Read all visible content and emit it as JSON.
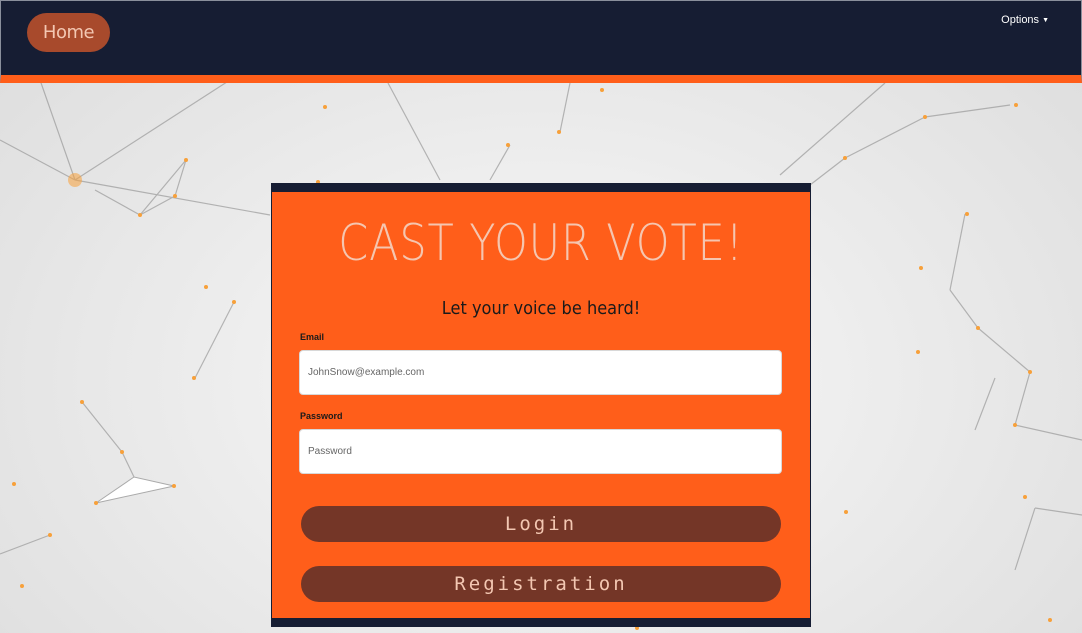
{
  "navbar": {
    "home_label": "Home",
    "options_label": "Options",
    "accent_color": "#ff5e1a",
    "background_color": "#161d33"
  },
  "card": {
    "title": "CAST YOUR VOTE!",
    "subtitle": "Let your voice be heard!",
    "email": {
      "label": "Email",
      "placeholder": "JohnSnow@example.com",
      "value": ""
    },
    "password": {
      "label": "Password",
      "placeholder": "Password",
      "value": ""
    },
    "login_label": "Login",
    "registration_label": "Registration",
    "background_color": "#ff5e1a",
    "button_color": "#743627"
  }
}
